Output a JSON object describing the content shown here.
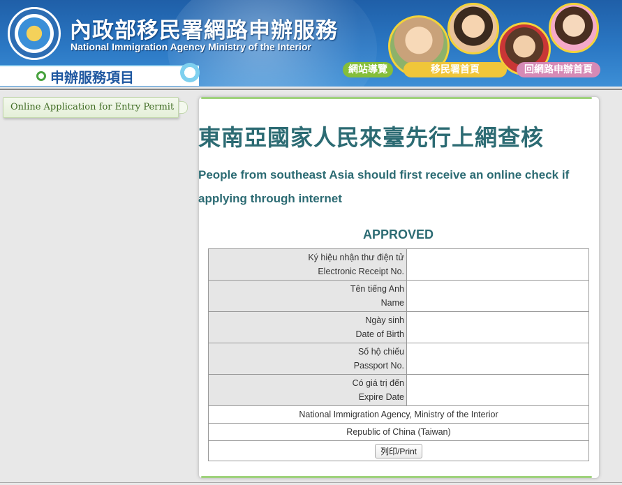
{
  "header": {
    "title_zh": "內政部移民署網路申辦服務",
    "title_en": "National Immigration Agency Ministry of the Interior",
    "service_label": "申辦服務項目",
    "nav": [
      "網站導覽",
      "移民署首頁",
      "回網路申辦首頁"
    ]
  },
  "sidebar": {
    "items": [
      {
        "label": "Online Application for Entry Permit"
      }
    ]
  },
  "main": {
    "title_zh": "東南亞國家人民來臺先行上網查核",
    "title_en": "People from southeast Asia should first receive an online check if applying through internet",
    "status": "APPROVED",
    "rows": [
      {
        "label_vi": "Ký hiệu nhận thư điện tử",
        "label_en": "Electronic Receipt No.",
        "value": ""
      },
      {
        "label_vi": "Tên tiếng Anh",
        "label_en": "Name",
        "value": ""
      },
      {
        "label_vi": "Ngày sinh",
        "label_en": "Date of Birth",
        "value": ""
      },
      {
        "label_vi": "Số hộ chiếu",
        "label_en": "Passport No.",
        "value": ""
      },
      {
        "label_vi": "Có giá trị đến",
        "label_en": "Expire Date",
        "value": ""
      }
    ],
    "footer_lines": [
      "National Immigration Agency, Ministry of the Interior",
      "Republic of China (Taiwan)"
    ],
    "print_label": "列印/Print"
  },
  "colors": {
    "header_blue": "#2b78c4",
    "title_teal": "#2c6b73",
    "sidebar_green": "#3f6b23",
    "accent_green": "#9fd27d"
  }
}
